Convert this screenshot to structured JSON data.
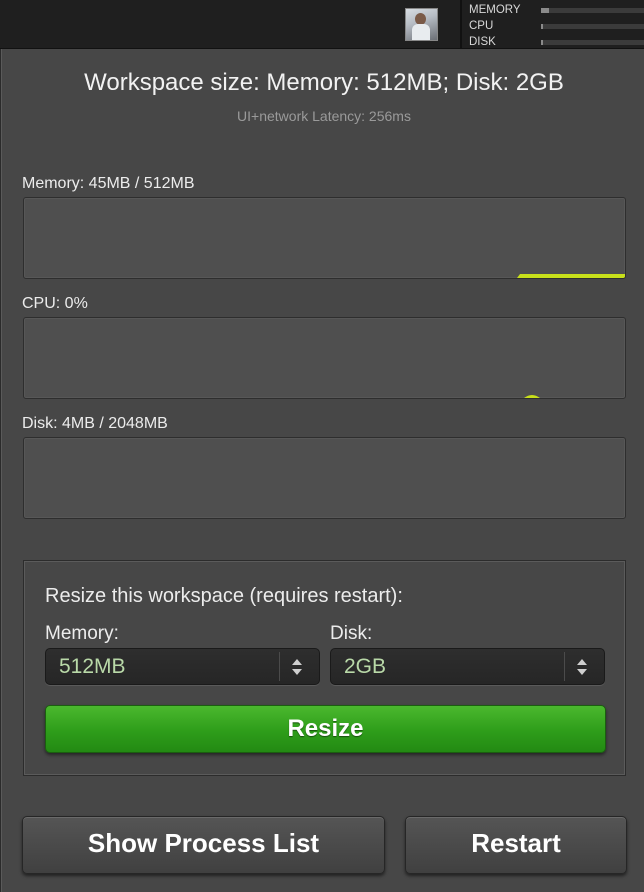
{
  "topbar": {
    "stats": [
      {
        "label": "MEMORY",
        "level_pct": 8
      },
      {
        "label": "CPU",
        "level_pct": 2
      },
      {
        "label": "DISK",
        "level_pct": 2
      }
    ]
  },
  "header": {
    "title": "Workspace size: Memory: 512MB; Disk: 2GB",
    "latency": "UI+network Latency: 256ms"
  },
  "metrics": [
    {
      "label": "Memory: 45MB / 512MB",
      "accent": "#c8e01a"
    },
    {
      "label": "CPU: 0%",
      "accent": "#c8e01a"
    },
    {
      "label": "Disk: 4MB / 2048MB",
      "accent": "#c8e01a"
    }
  ],
  "resize": {
    "title": "Resize this workspace (requires restart):",
    "memory_label": "Memory:",
    "memory_value": "512MB",
    "disk_label": "Disk:",
    "disk_value": "2GB",
    "button_label": "Resize"
  },
  "actions": {
    "process_list_label": "Show Process List",
    "restart_label": "Restart"
  },
  "colors": {
    "accent_green": "#2e9d1a",
    "graph_line": "#c8e01a",
    "select_text": "#b9d9a8"
  }
}
